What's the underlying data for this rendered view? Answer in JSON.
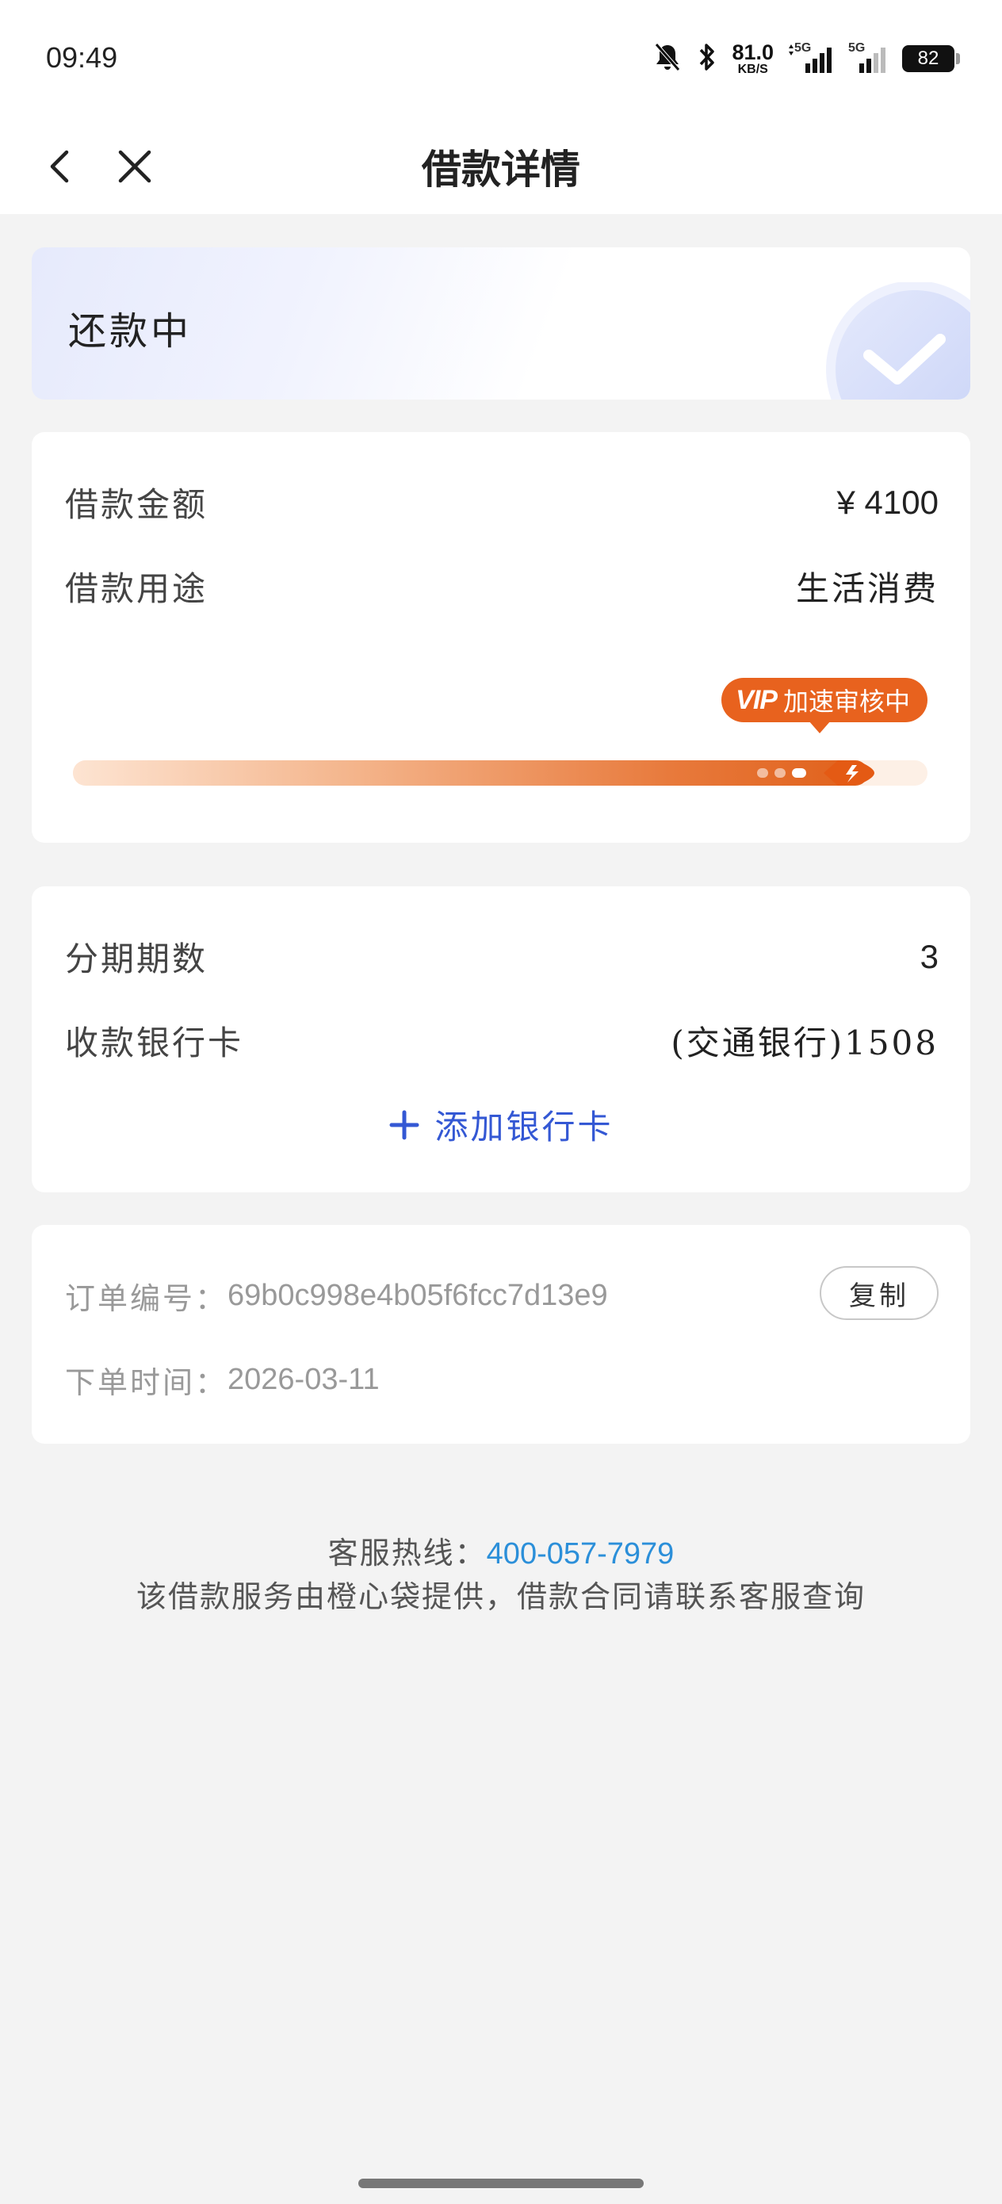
{
  "status_bar": {
    "time": "09:49",
    "net_speed_value": "81.0",
    "net_speed_unit": "KB/S",
    "battery": "82",
    "signal_1": "5G",
    "signal_2": "5G"
  },
  "nav": {
    "title": "借款详情"
  },
  "status": {
    "text": "还款中"
  },
  "loan": {
    "amount_label": "借款金额",
    "amount_value": "¥ 4100",
    "purpose_label": "借款用途",
    "purpose_value": "生活消费",
    "vip_text": "VIP",
    "badge_text": "加速审核中",
    "progress": 0.93,
    "accent_color": "#e8621e"
  },
  "installment": {
    "periods_label": "分期期数",
    "periods_value": "3",
    "bank_label": "收款银行卡",
    "bank_value": "(交通银行)1508",
    "add_card_label": "添加银行卡",
    "link_color": "#3458d4"
  },
  "order": {
    "number_label": "订单编号：",
    "number_value": "69b0c998e4b05f6fcc7d13e9",
    "copy_label": "复制",
    "time_label": "下单时间：",
    "time_value": "2026-03-11"
  },
  "footer": {
    "hotline_label": "客服热线：",
    "hotline_number": "400-057-7979",
    "disclaimer": "该借款服务由橙心袋提供，借款合同请联系客服查询"
  }
}
